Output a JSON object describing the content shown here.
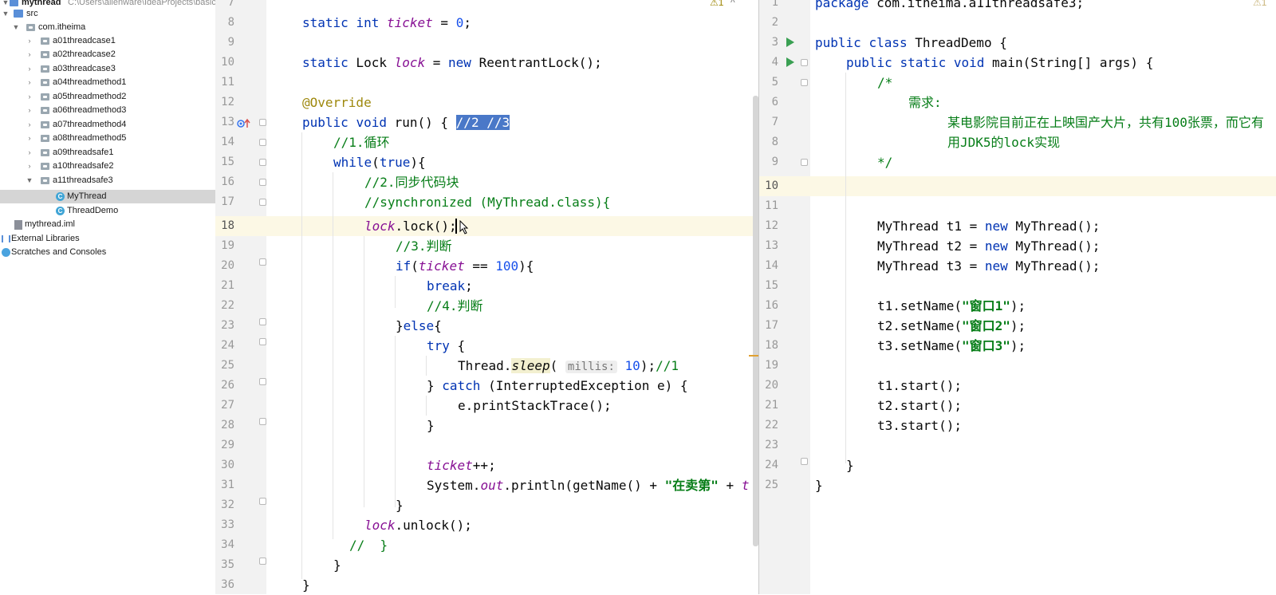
{
  "project_tree": {
    "root_label": "mythread",
    "root_path": "C:\\Users\\alienware\\IdeaProjects\\basic-",
    "src_label": "src",
    "package_label": "com.itheima",
    "packages": [
      "a01threadcase1",
      "a02threadcase2",
      "a03threadcase3",
      "a04threadmethod1",
      "a05threadmethod2",
      "a06threadmethod3",
      "a07threadmethod4",
      "a08threadmethod5",
      "a09threadsafe1",
      "a10threadsafe2",
      "a11threadsafe3"
    ],
    "open_package_files": [
      "MyThread",
      "ThreadDemo"
    ],
    "class_icon_letter": "C",
    "iml_file": "mythread.iml",
    "external_libraries": "External Libraries",
    "scratches": "Scratches and Consoles"
  },
  "left_editor": {
    "warning_badge": "⚠1",
    "line_numbers": [
      "7",
      "8",
      "9",
      "10",
      "11",
      "12",
      "13",
      "14",
      "15",
      "16",
      "17",
      "18",
      "19",
      "20",
      "21",
      "22",
      "23",
      "24",
      "25",
      "26",
      "27",
      "28",
      "29",
      "30",
      "31",
      "32",
      "33",
      "34",
      "35",
      "36"
    ],
    "current_line": "18",
    "code": {
      "l8_static": "static",
      "l8_int": "int",
      "l8_var": "ticket",
      "l8_eq": " = ",
      "l8_val": "0",
      "l8_end": ";",
      "l10_static": "static",
      "l10_type": " Lock ",
      "l10_var": "lock",
      "l10_eq": " = ",
      "l10_new": "new",
      "l10_rest": " ReentrantLock();",
      "l12_ann": "@Override",
      "l13_public": "public",
      "l13_void": "void",
      "l13_rest": " run() { ",
      "l13_sel": "//2 //3",
      "l14": "//1.循环",
      "l15_while": "while",
      "l15_p1": "(",
      "l15_true": "true",
      "l15_p2": "){",
      "l16": "//2.同步代码块",
      "l17": "//synchronized (MyThread.class){",
      "l18_lock": "lock",
      "l18_rest": ".lock();",
      "l19": "//3.判断",
      "l20_if": "if",
      "l20_p": "(",
      "l20_var": "ticket",
      "l20_op": " == ",
      "l20_num": "100",
      "l20_end": "){",
      "l21_break": "break",
      "l21_end": ";",
      "l22": "//4.判断",
      "l23_br": "}",
      "l23_else": "else",
      "l23_end": "{",
      "l24_try": "try",
      "l24_end": " {",
      "l25_cls": "Thread.",
      "l25_sleep": "sleep",
      "l25_p": "(",
      "l25_hint": "millis:",
      "l25_num": "10",
      "l25_end": ");",
      "l25_cm": "//1",
      "l26_br": "} ",
      "l26_catch": "catch",
      "l26_rest": " (InterruptedException e) {",
      "l27": "e.printStackTrace();",
      "l28": "}",
      "l30_var": "ticket",
      "l30_end": "++;",
      "l31_a": "System.",
      "l31_out": "out",
      "l31_b": ".println(getName() + ",
      "l31_str": "\"在卖第\"",
      "l31_c": " + ",
      "l31_tail": "t",
      "l32": "}",
      "l33_lock": "lock",
      "l33_rest": ".unlock();",
      "l34": "//  }",
      "l35": "}",
      "l36": "}"
    }
  },
  "right_editor": {
    "warning_badge": "⚠1",
    "line_numbers": [
      "1",
      "2",
      "3",
      "4",
      "5",
      "6",
      "7",
      "8",
      "9",
      "10",
      "11",
      "12",
      "13",
      "14",
      "15",
      "16",
      "17",
      "18",
      "19",
      "20",
      "21",
      "22",
      "23",
      "24",
      "25"
    ],
    "current_line": "10",
    "code": {
      "l1_pkg": "package",
      "l1_rest": " com.itheima.a11threadsafe3;",
      "l3_public": "public",
      "l3_class": "class",
      "l3_rest": " ThreadDemo {",
      "l4_public": "public",
      "l4_static": "static",
      "l4_void": "void",
      "l4_rest": " main(String[] args) {",
      "l5": "/*",
      "l6": "需求:",
      "l7": "某电影院目前正在上映国产大片，共有100张票，而它有",
      "l8": "用JDK5的lock实现",
      "l9": "*/",
      "l12_a": "MyThread t1 = ",
      "l12_new": "new",
      "l12_b": " MyThread();",
      "l13_a": "MyThread t2 = ",
      "l13_new": "new",
      "l13_b": " MyThread();",
      "l14_a": "MyThread t3 = ",
      "l14_new": "new",
      "l14_b": " MyThread();",
      "l16_a": "t1.setName(",
      "l16_s": "\"窗口1\"",
      "l16_b": ");",
      "l17_a": "t2.setName(",
      "l17_s": "\"窗口2\"",
      "l17_b": ");",
      "l18_a": "t3.setName(",
      "l18_s": "\"窗口3\"",
      "l18_b": ");",
      "l20": "t1.start();",
      "l21": "t2.start();",
      "l22": "t3.start();",
      "l24": "}",
      "l25": "}"
    }
  },
  "colors": {
    "keyword": "#0033b3",
    "comment": "#8c8c8c",
    "string": "#067d17",
    "field": "#871094",
    "number": "#1750eb",
    "selection": "#4a78c8",
    "current_line": "#fcf8e5"
  }
}
